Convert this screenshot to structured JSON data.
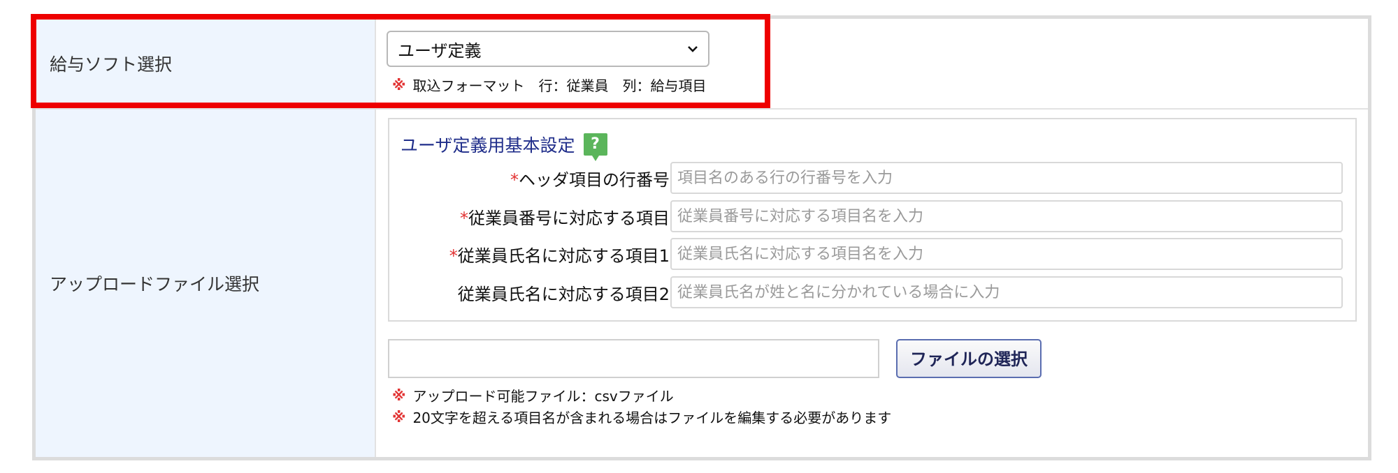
{
  "row1": {
    "label": "給与ソフト選択",
    "select_value": "ユーザ定義",
    "note": "取込フォーマット　行：従業員　列：給与項目"
  },
  "row2": {
    "label": "アップロードファイル選択",
    "section_title": "ユーザ定義用基本設定",
    "help_glyph": "?",
    "fields": [
      {
        "required": "*",
        "label": "ヘッダ項目の行番号",
        "placeholder": "項目名のある行の行番号を入力"
      },
      {
        "required": "*",
        "label": "従業員番号に対応する項目",
        "placeholder": "従業員番号に対応する項目名を入力"
      },
      {
        "required": "*",
        "label": "従業員氏名に対応する項目1",
        "placeholder": "従業員氏名に対応する項目名を入力"
      },
      {
        "required": "",
        "label": "従業員氏名に対応する項目2",
        "placeholder": "従業員氏名が姓と名に分かれている場合に入力"
      }
    ],
    "file_button": "ファイルの選択",
    "notes": [
      "アップロード可能ファイル：csvファイル",
      "20文字を超える項目名が含まれる場合はファイルを編集する必要があります"
    ]
  },
  "note_mark": "※",
  "colors": {
    "label_bg": "#eef5fe",
    "highlight": "#ee0000",
    "required": "#e23333",
    "title": "#1f2d8a",
    "help": "#5bb55b"
  }
}
